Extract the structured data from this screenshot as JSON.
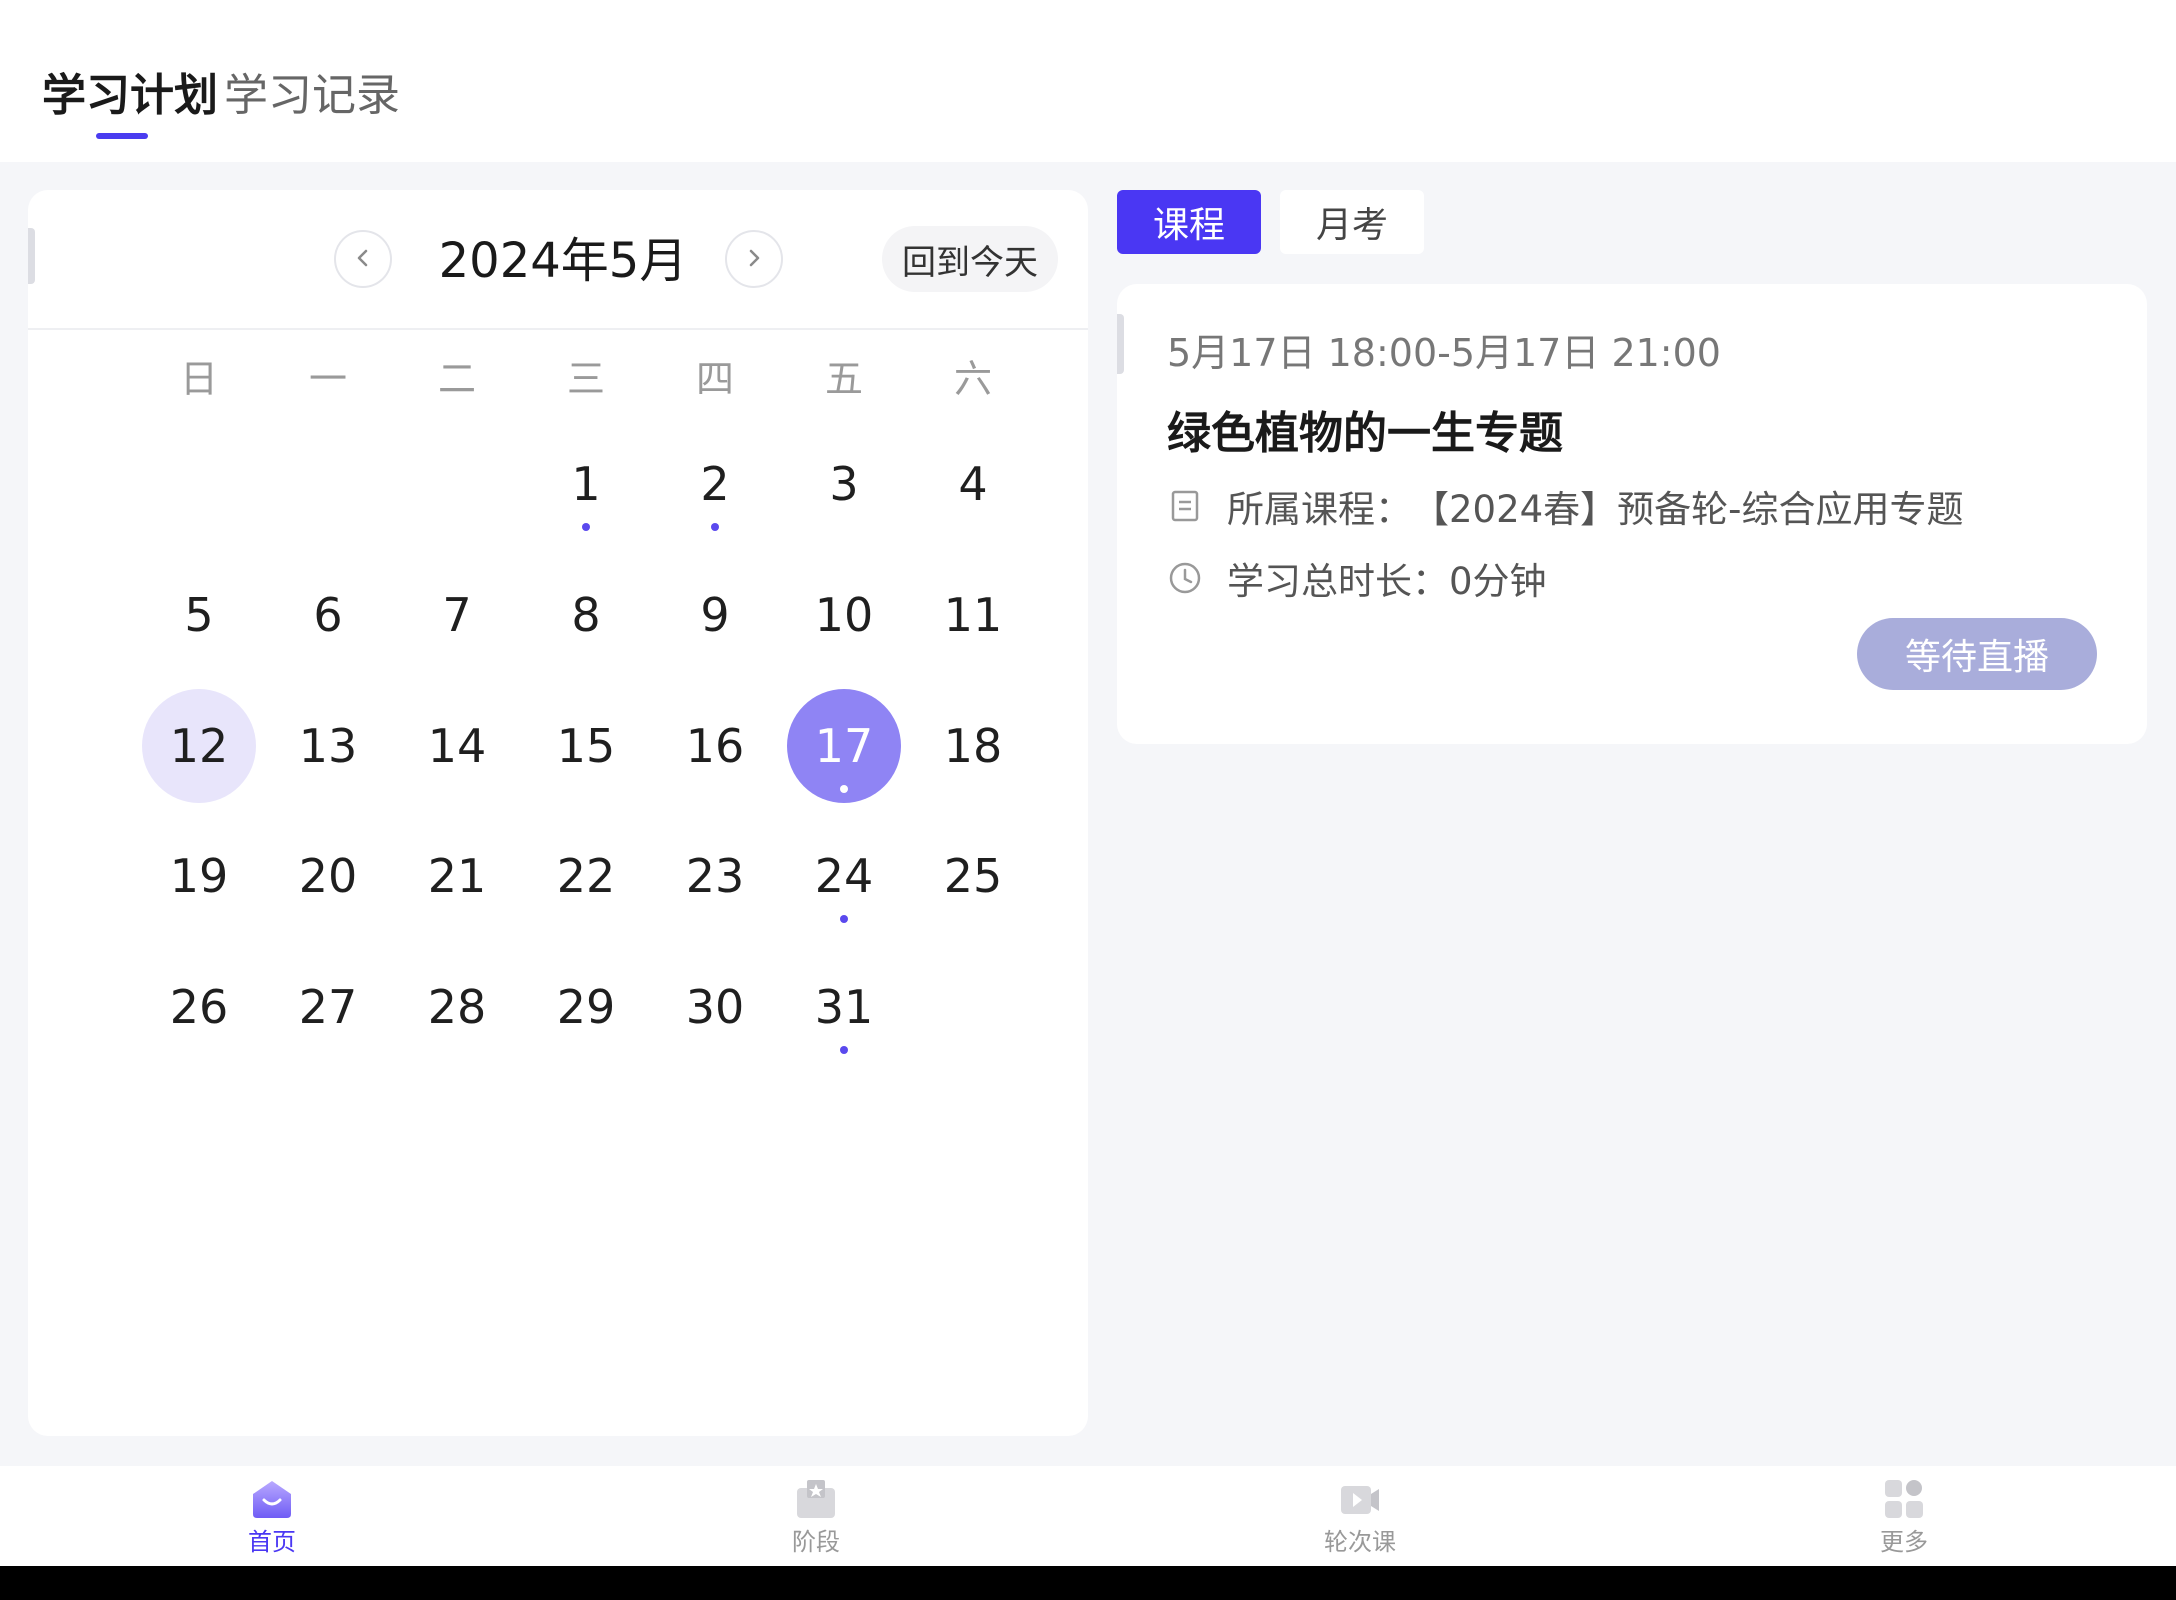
{
  "header": {
    "tabs": [
      {
        "label": "学习计划",
        "active": true
      },
      {
        "label": "学习记录",
        "active": false
      }
    ]
  },
  "calendar": {
    "month_title": "2024年5月",
    "prev_icon": "chevron-left-icon",
    "next_icon": "chevron-right-icon",
    "today_button": "回到今天",
    "weekdays": [
      "日",
      "一",
      "二",
      "三",
      "四",
      "五",
      "六"
    ],
    "days": [
      "1",
      "2",
      "3",
      "4",
      "5",
      "6",
      "7",
      "8",
      "9",
      "10",
      "11",
      "12",
      "13",
      "14",
      "15",
      "16",
      "17",
      "18",
      "19",
      "20",
      "21",
      "22",
      "23",
      "24",
      "25",
      "26",
      "27",
      "28",
      "29",
      "30",
      "31"
    ],
    "first_weekday_index": 3,
    "today": "12",
    "selected": "17",
    "days_with_events": [
      "1",
      "2",
      "17",
      "24",
      "31"
    ],
    "accent_color": "#4a37f3",
    "selected_color": "#8f84f4",
    "today_color": "#e8e5fb"
  },
  "right_tabs": [
    {
      "label": "课程",
      "active": true
    },
    {
      "label": "月考",
      "active": false
    }
  ],
  "course": {
    "time": "5月17日 18:00-5月17日 21:00",
    "title": "绿色植物的一生专题",
    "course_label": "所属课程：",
    "course_name": "【2024春】预备轮-综合应用专题",
    "duration_label": "学习总时长：",
    "duration_value": "0分钟",
    "status_button": "等待直播",
    "course_icon": "document-icon",
    "duration_icon": "clock-icon"
  },
  "bottom_nav": [
    {
      "label": "首页",
      "icon": "home-icon",
      "active": true
    },
    {
      "label": "阶段",
      "icon": "stage-icon",
      "active": false
    },
    {
      "label": "轮次课",
      "icon": "video-icon",
      "active": false
    },
    {
      "label": "更多",
      "icon": "more-grid-icon",
      "active": false
    }
  ]
}
